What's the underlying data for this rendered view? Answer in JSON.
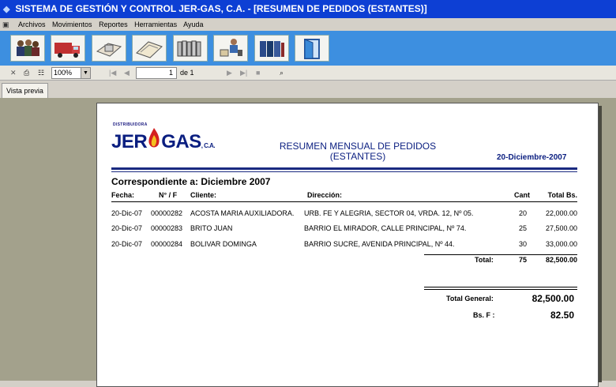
{
  "window": {
    "title": "SISTEMA DE GESTIÓN Y CONTROL JER-GAS, C.A. - [RESUMEN DE PEDIDOS (ESTANTES)]"
  },
  "menu": {
    "items": [
      "Archivos",
      "Movimientos",
      "Reportes",
      "Herramientas",
      "Ayuda"
    ]
  },
  "toolbar": {
    "buttons": [
      "people-icon",
      "truck-icon",
      "cylinder-icon",
      "folder-icon",
      "books-icon",
      "worker-icon",
      "ledger-icon",
      "exit-door-icon"
    ]
  },
  "viewer": {
    "zoom": "100%",
    "page": "1",
    "page_of": "de 1",
    "tab": "Vista previa"
  },
  "report": {
    "logo_small": "DISTRIBUIDORA",
    "logo_left": "JER",
    "logo_right": "GAS",
    "logo_suffix": ", C.A.",
    "title_line1": "RESUMEN MENSUAL DE PEDIDOS",
    "title_line2": "(ESTANTES)",
    "date": "20-Diciembre-2007",
    "corresponding_label": "Correspondiente a:",
    "corresponding_value": "Diciembre 2007",
    "headers": {
      "fecha": "Fecha:",
      "num": "N° / F",
      "cliente": "Cliente:",
      "direccion": "Dirección:",
      "cant": "Cant",
      "total": "Total Bs."
    },
    "rows": [
      {
        "fecha": "20-Dic-07",
        "num": "00000282",
        "cliente": "ACOSTA MARIA AUXILIADORA.",
        "direccion": "URB. FE Y ALEGRIA, SECTOR 04, VRDA. 12, Nº 05.",
        "cant": "20",
        "total": "22,000.00"
      },
      {
        "fecha": "20-Dic-07",
        "num": "00000283",
        "cliente": "BRITO JUAN",
        "direccion": "BARRIO EL MIRADOR, CALLE PRINCIPAL, Nº 74.",
        "cant": "25",
        "total": "27,500.00"
      },
      {
        "fecha": "20-Dic-07",
        "num": "00000284",
        "cliente": "BOLIVAR DOMINGA",
        "direccion": "BARRIO SUCRE, AVENIDA PRINCIPAL, Nº 44.",
        "cant": "30",
        "total": "33,000.00"
      }
    ],
    "total_label": "Total:",
    "total_cant": "75",
    "total_amount": "82,500.00",
    "grand_total_label": "Total General:",
    "grand_total_value": "82,500.00",
    "bsf_label": "Bs. F :",
    "bsf_value": "82.50"
  }
}
